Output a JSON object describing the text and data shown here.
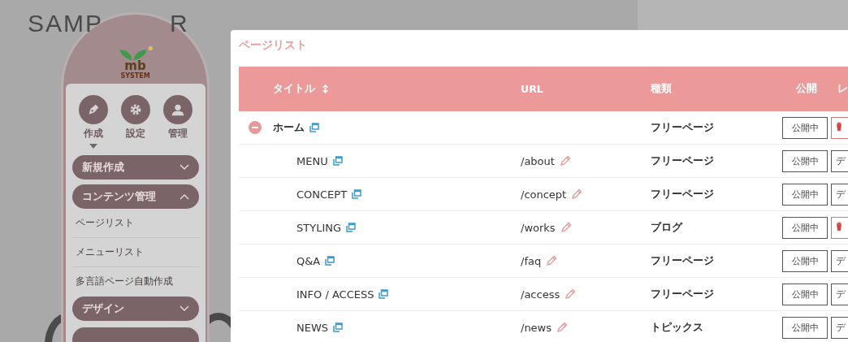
{
  "background": {
    "title_parts": [
      "SAMP",
      "R"
    ]
  },
  "sidebar": {
    "logo": {
      "text": "mb",
      "subtext": "SYSTEM"
    },
    "nav": [
      {
        "label": "作成",
        "selected": true
      },
      {
        "label": "設定",
        "selected": false
      },
      {
        "label": "管理",
        "selected": false
      }
    ],
    "sections": [
      {
        "label": "新規作成",
        "expanded": false
      },
      {
        "label": "コンテンツ管理",
        "expanded": true,
        "items": [
          "ページリスト",
          "メニューリスト",
          "多言語ページ自動作成"
        ]
      },
      {
        "label": "デザイン",
        "expanded": false
      }
    ]
  },
  "dialog": {
    "title": "ページリスト",
    "columns": [
      "タイトル",
      "URL",
      "種類",
      "公開",
      "レ"
    ],
    "rows": [
      {
        "title": "ホーム",
        "type": "フリーページ",
        "publish": "公開中",
        "layout": {
          "kind": "delete"
        },
        "expanded": true,
        "children": [
          {
            "title": "MENU",
            "url": "/about",
            "type": "フリーページ",
            "publish": "公開中",
            "layout": {
              "kind": "text",
              "label": "デ"
            }
          },
          {
            "title": "CONCEPT",
            "url": "/concept",
            "type": "フリーページ",
            "publish": "公開中",
            "layout": {
              "kind": "text",
              "label": "デ"
            }
          },
          {
            "title": "STYLING",
            "url": "/works",
            "type": "ブログ",
            "publish": "公開中",
            "layout": {
              "kind": "delete"
            }
          },
          {
            "title": "Q&A",
            "url": "/faq",
            "type": "フリーページ",
            "publish": "公開中",
            "layout": {
              "kind": "text",
              "label": "デ"
            }
          },
          {
            "title": "INFO / ACCESS",
            "url": "/access",
            "type": "フリーページ",
            "publish": "公開中",
            "layout": {
              "kind": "text",
              "label": "デ"
            }
          },
          {
            "title": "NEWS",
            "url": "/news",
            "type": "トピックス",
            "publish": "公開中",
            "layout": {
              "kind": "text",
              "label": "デ"
            }
          }
        ]
      }
    ]
  }
}
